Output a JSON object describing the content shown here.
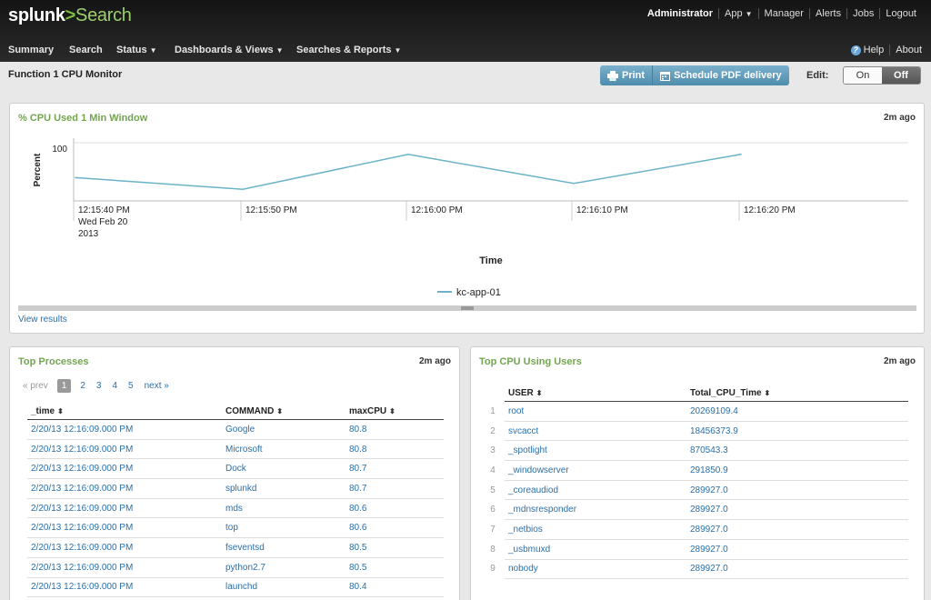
{
  "app": {
    "logo_splunk": "splunk",
    "logo_arrow": ">",
    "logo_search": "Search"
  },
  "topnav": {
    "user": "Administrator",
    "app": "App",
    "manager": "Manager",
    "alerts": "Alerts",
    "jobs": "Jobs",
    "logout": "Logout"
  },
  "mainnav": {
    "summary": "Summary",
    "search": "Search",
    "status": "Status",
    "dashboards": "Dashboards & Views",
    "searches": "Searches & Reports",
    "help": "Help",
    "about": "About"
  },
  "page": {
    "title": "Function 1 CPU Monitor",
    "print": "Print",
    "schedule": "Schedule PDF delivery",
    "edit_label": "Edit:",
    "toggle_on": "On",
    "toggle_off": "Off"
  },
  "cpu_panel": {
    "title": "% CPU Used 1 Min Window",
    "time": "2m ago",
    "view_results": "View results"
  },
  "chart_data": {
    "type": "line",
    "ylabel": "Percent",
    "xlabel": "Time",
    "y_tick": "100",
    "x_ticks": [
      "12:15:40 PM",
      "12:15:50 PM",
      "12:16:00 PM",
      "12:16:10 PM",
      "12:16:20 PM"
    ],
    "x_tick_sub": [
      "Wed Feb 20",
      "2013"
    ],
    "series": [
      {
        "name": "kc-app-01",
        "x": [
          "12:15:40 PM",
          "12:15:50 PM",
          "12:16:00 PM",
          "12:16:10 PM",
          "12:16:20 PM"
        ],
        "values": [
          81,
          80.8,
          81.4,
          80.9,
          81.4
        ]
      }
    ],
    "legend_position": "bottom",
    "color": "#6bb3c8"
  },
  "processes": {
    "title": "Top Processes",
    "time": "2m ago",
    "pager": {
      "prev": "« prev",
      "pages": [
        "1",
        "2",
        "3",
        "4",
        "5"
      ],
      "next": "next »"
    },
    "columns": [
      "_time",
      "COMMAND",
      "maxCPU"
    ],
    "rows": [
      [
        "2/20/13 12:16:09.000 PM",
        "Google",
        "80.8"
      ],
      [
        "2/20/13 12:16:09.000 PM",
        "Microsoft",
        "80.8"
      ],
      [
        "2/20/13 12:16:09.000 PM",
        "Dock",
        "80.7"
      ],
      [
        "2/20/13 12:16:09.000 PM",
        "splunkd",
        "80.7"
      ],
      [
        "2/20/13 12:16:09.000 PM",
        "mds",
        "80.6"
      ],
      [
        "2/20/13 12:16:09.000 PM",
        "top",
        "80.6"
      ],
      [
        "2/20/13 12:16:09.000 PM",
        "fseventsd",
        "80.5"
      ],
      [
        "2/20/13 12:16:09.000 PM",
        "python2.7",
        "80.5"
      ],
      [
        "2/20/13 12:16:09.000 PM",
        "launchd",
        "80.4"
      ]
    ]
  },
  "users": {
    "title": "Top CPU Using Users",
    "time": "2m ago",
    "columns": [
      "USER",
      "Total_CPU_Time"
    ],
    "rows": [
      [
        "1",
        "root",
        "20269109.4"
      ],
      [
        "2",
        "svcacct",
        "18456373.9"
      ],
      [
        "3",
        "_spotlight",
        "870543.3"
      ],
      [
        "4",
        "_windowserver",
        "291850.9"
      ],
      [
        "5",
        "_coreaudiod",
        "289927.0"
      ],
      [
        "6",
        "_mdnsresponder",
        "289927.0"
      ],
      [
        "7",
        "_netbios",
        "289927.0"
      ],
      [
        "8",
        "_usbmuxd",
        "289927.0"
      ],
      [
        "9",
        "nobody",
        "289927.0"
      ]
    ]
  }
}
